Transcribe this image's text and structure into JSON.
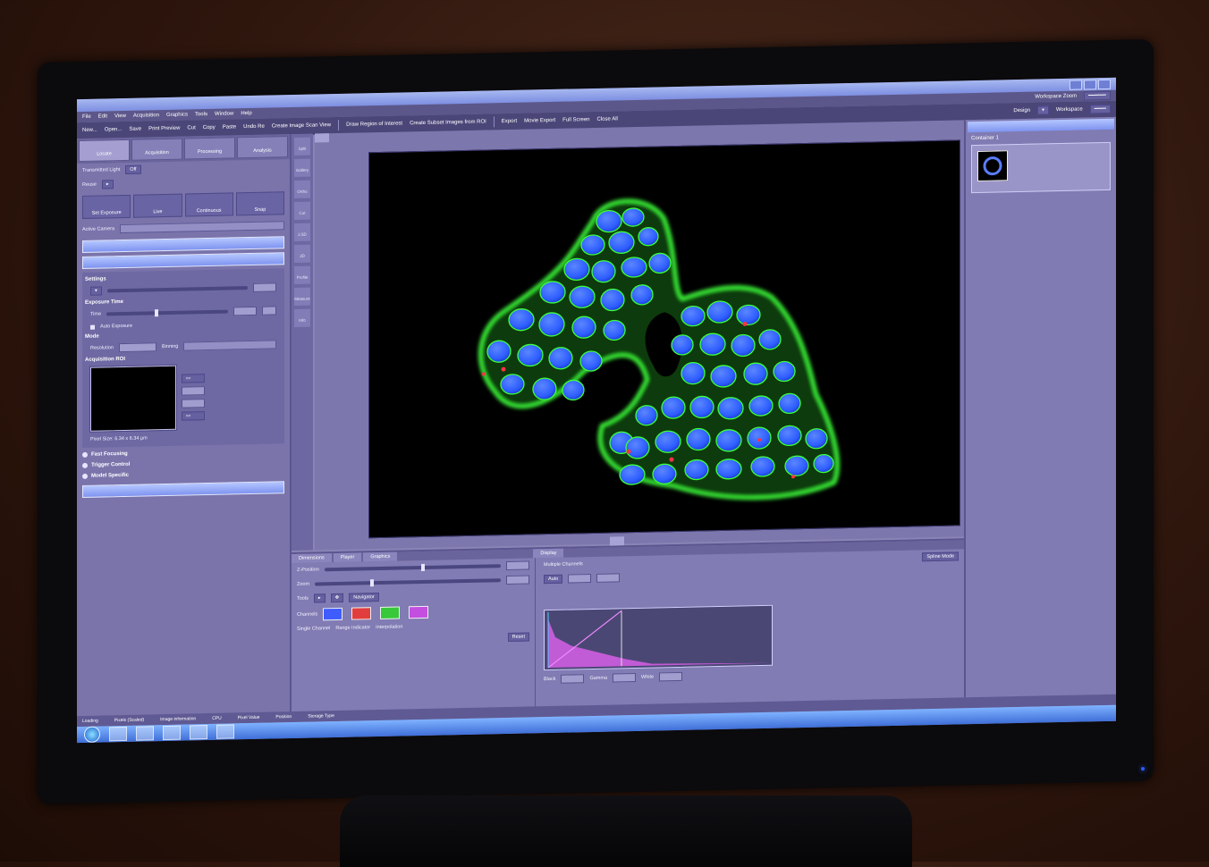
{
  "window": {
    "title": ""
  },
  "menu": {
    "items": [
      "File",
      "Edit",
      "View",
      "Acquisition",
      "Graphics",
      "Tools",
      "Window",
      "Help"
    ],
    "workspace_label": "Workspace Zoom"
  },
  "toolbar": {
    "items": [
      "New...",
      "Open...",
      "Save",
      "Print Preview",
      "Cut",
      "Copy",
      "Paste",
      "Undo Re",
      "Create Image Scan View",
      "Draw Region of Interest",
      "Create Subset Images from ROI",
      "Export",
      "Movie Export",
      "Full Screen",
      "Close All"
    ],
    "design_label": "Design",
    "workspace_label": "Workspace"
  },
  "left_panel": {
    "tabs": [
      "Locate",
      "Acquisition",
      "Processing",
      "Analysis"
    ],
    "transmitted_light_label": "Transmitted Light",
    "transmitted_light_value": "Off",
    "reuse_label": "Reuse",
    "buttons": [
      "Set Exposure",
      "Live",
      "Continuous",
      "Snap"
    ],
    "active_camera_label": "Active Camera",
    "exposure_time_label": "Exposure Time",
    "time_label": "Time",
    "auto_exposure_label": "Auto Exposure",
    "settings_label": "Settings",
    "mode_label": "Mode",
    "resolution_label": "Resolution",
    "binning_label": "Binning",
    "acq_roi_label": "Acquisition ROI",
    "pixel_size": "Pixel Size: 6.34 x 6.34 µm",
    "radio_items": [
      "Fast Focusing",
      "Trigger Control",
      "Model Specific"
    ]
  },
  "side_strip": {
    "items": [
      "Split",
      "Gallery",
      "Ortho",
      "Cut",
      "2.5D",
      "3D",
      "Profile",
      "Measure",
      "Info"
    ]
  },
  "center": {
    "doc_tab": "",
    "view_tab": ""
  },
  "bottom_panel": {
    "tabs": [
      "Dimensions",
      "Player",
      "Graphics"
    ],
    "right_tab": "Display",
    "z_position_label": "Z-Position",
    "zoom_label": "Zoom",
    "tools_label": "Tools",
    "channels_label": "Channels",
    "single_channel_label": "Single Channel",
    "range_indicator_label": "Range Indicator",
    "interpolation_label": "Interpolation",
    "navigator_label": "Navigator",
    "reset_label": "Reset",
    "multiple_channels_label": "Multiple Channels",
    "auto_label": "Auto",
    "black_label": "Black",
    "gamma_label": "Gamma",
    "white_label": "White",
    "spline_mode_label": "Spline Mode"
  },
  "right_panel": {
    "title": "Container 1"
  },
  "status": {
    "loading_label": "Loading",
    "pixels_label": "Pixels (Scaled)",
    "image_info": "Image information",
    "cpu_label": "CPU",
    "position_label": "Position",
    "pixel_value_label": "Pixel Value",
    "storage_label": "Storage Type"
  },
  "colors": {
    "panel": "#7a74ab",
    "accent": "#7f94f0",
    "nucleus": "#2d5dff",
    "membrane": "#34e03a"
  }
}
